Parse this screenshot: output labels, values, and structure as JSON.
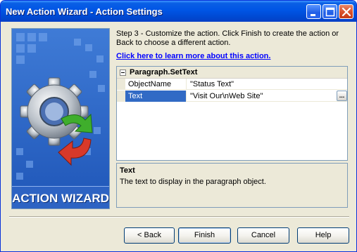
{
  "window": {
    "title": "New Action Wizard - Action Settings",
    "controls": [
      "minimize",
      "maximize",
      "close"
    ],
    "titlebar_color": "#0055e5"
  },
  "banner": {
    "label": "ACTION WIZARD",
    "icons": [
      "gear-icon",
      "green-arrow-icon",
      "red-arrow-icon"
    ]
  },
  "instructions": {
    "text": "Step 3 - Customize the action.  Click Finish to create the action or Back to choose a different action."
  },
  "learn_link": {
    "label": "Click here to learn more about this action."
  },
  "property_grid": {
    "group_label": "Paragraph.SetText",
    "rows": [
      {
        "name": "ObjectName",
        "value": "\"Status Text\""
      },
      {
        "name": "Text",
        "value": "\"Visit Our\\nWeb Site\"",
        "selected": true,
        "has_browse": true
      }
    ],
    "browse_label": "..."
  },
  "description": {
    "title": "Text",
    "text": "The text to display in the paragraph object."
  },
  "buttons": {
    "back": "< Back",
    "finish": "Finish",
    "cancel": "Cancel",
    "help": "Help"
  },
  "colors": {
    "selection": "#316ac5",
    "link": "#0000ff",
    "dialog_bg": "#ece9d8"
  }
}
